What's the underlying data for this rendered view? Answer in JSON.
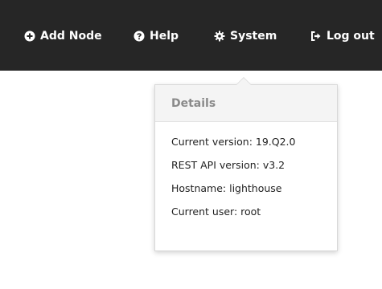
{
  "navbar": {
    "add_node": {
      "label": "Add Node",
      "icon": "plus-circle-icon"
    },
    "help": {
      "label": "Help",
      "icon": "question-circle-icon"
    },
    "system": {
      "label": "System",
      "icon": "gear-icon"
    },
    "logout": {
      "label": "Log out",
      "icon": "logout-icon"
    }
  },
  "system_dropdown": {
    "header": "Details",
    "items": [
      {
        "label": "Current version: 19.Q2.0"
      },
      {
        "label": "REST API version: v3.2"
      },
      {
        "label": "Hostname: lighthouse"
      },
      {
        "label": "Current user: root"
      }
    ]
  },
  "colors": {
    "navbar_bg": "#262626",
    "nav_text": "#ffffff",
    "dropdown_header_bg": "#f4f4f4",
    "dropdown_header_text": "#8a8a8a"
  }
}
